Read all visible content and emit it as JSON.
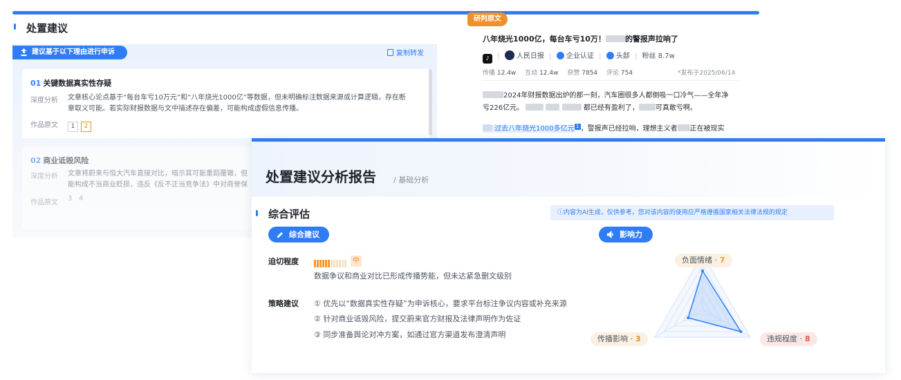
{
  "back_panel": {
    "title": "处置建议",
    "reason_button": "建议基于以下理由进行申诉",
    "copy_label": "复制转发",
    "items": [
      {
        "num": "01",
        "title": "关键数据真实性存疑",
        "analysis_label": "深度分析",
        "analysis_line1": "文章核心论点基于“每台车亏10万元”和“八年烧光1000亿”等数据，但未明确标注数据来源或计算逻辑，存在断",
        "analysis_line2": "章取义可能。若实际财报数据与文中描述存在偏差，可能构成虚假信息传播。",
        "source_label": "作品原文",
        "refs": [
          "1",
          "2"
        ]
      },
      {
        "num": "02",
        "title": "商业诋毁风险",
        "analysis_label": "深度分析",
        "analysis_line1": "文章将蔚来与恒大汽车直接对比，暗示其可能重蹈覆辙，但",
        "analysis_line2": "能构成不当商业贬损，违反《反不正当竞争法》中对商誉保",
        "source_label": "作品原文",
        "refs": [
          "3",
          "4"
        ]
      }
    ]
  },
  "article": {
    "tag": "研判原文",
    "title_a": "八年烧光1000亿，每台车亏10万！",
    "title_b": "的警报声拉响了",
    "platform_icon": "tiktok-icon",
    "author": "人民日报",
    "verified": "企业认证",
    "rank": "头部",
    "fans_label": "粉丝",
    "fans": "8.7w",
    "stats": [
      {
        "label": "传播",
        "value": "12.4w"
      },
      {
        "label": "互动",
        "value": "12.4w"
      },
      {
        "label": "获赞",
        "value": "7854"
      },
      {
        "label": "评论",
        "value": "754"
      }
    ],
    "date": "*发布于2025/06/14",
    "p1a": "2024年财报数据出炉的那一刻，汽车圈很多人都倒吸一口冷气——全年净",
    "p1b": "亏226亿元。",
    "p1c": "都已经有盈利了，",
    "p1d": "可真敢亏啊。",
    "p2_highlight": "过去八年烧光1000多亿元",
    "p2_sup": "1",
    "p2_rest": "，警报声已经拉响，理想主义者",
    "p2_end": "正在被现实"
  },
  "report": {
    "title": "处置建议分析报告",
    "subtitle": "/ 基础分析",
    "section_title": "综合评估",
    "notice": "ⓘ内容为AI生成，仅供参考，您对该内容的使用应严格遵循国家相关法律法规的规定",
    "btn_suggest": "综合建议",
    "btn_impact": "影响力",
    "urgency_label": "迫切程度",
    "urgency_level": "中",
    "urgency_fraction": 0.5,
    "urgency_desc": "数据争议和商业对比已形成传播势能，但未达紧急删文级别",
    "strategy_label": "策略建议",
    "strategies": [
      "① 优先以“数据真实性存疑”为申诉核心，要求平台标注争议内容或补充来源",
      "② 针对商业诋毁风险，提交蔚来官方财报及法律声明作为佐证",
      "③ 同步准备舆论对冲方案，如通过官方渠道发布澄清声明"
    ]
  },
  "radar": {
    "max": 10,
    "axes": [
      {
        "label": "负面情绪",
        "value": 7,
        "color": "#f0a020"
      },
      {
        "label": "传播影响",
        "value": 3,
        "color": "#e58c1f"
      },
      {
        "label": "违规程度",
        "value": 8,
        "color": "#e05b4a"
      }
    ],
    "stroke": "#2f7df6",
    "fill": "#bcd6f8"
  }
}
